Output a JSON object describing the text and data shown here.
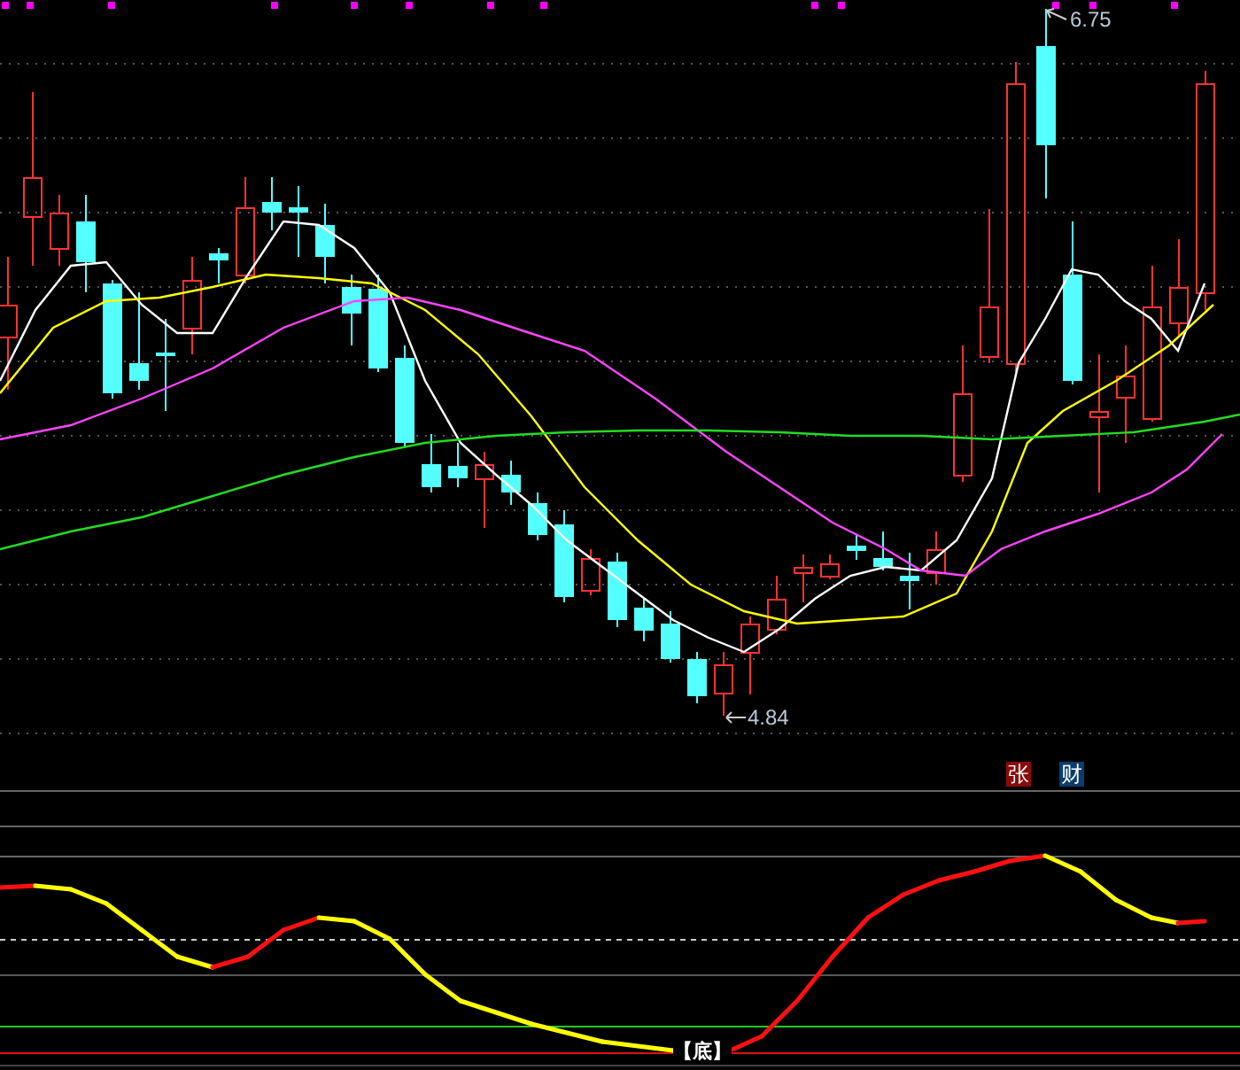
{
  "main_chart": {
    "high_label": "6.75",
    "low_label": "4.84"
  },
  "badges": [
    {
      "text": "张",
      "color": "#8b0a0a"
    },
    {
      "text": "财",
      "color": "#0b3c6e"
    }
  ],
  "indicator": {
    "bottom_label": "【底】"
  }
}
